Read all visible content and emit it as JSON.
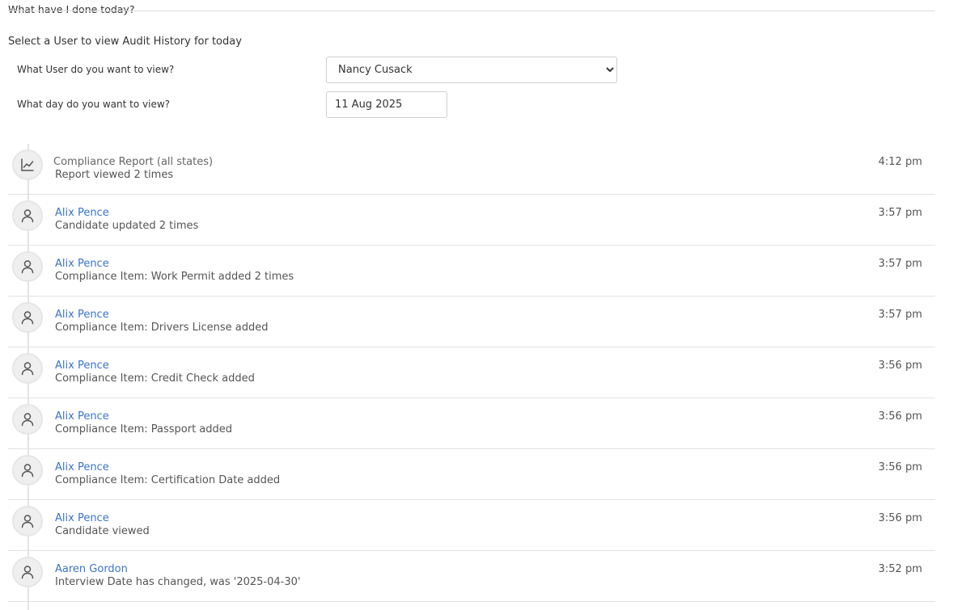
{
  "header": {
    "legend": "What have I done today?",
    "intro": "Select a User to view Audit History for today"
  },
  "form": {
    "user_label": "What User do you want to view?",
    "user_selected": "Nancy Cusack",
    "day_label": "What day do you want to view?",
    "day_value": "11 Aug 2025"
  },
  "entries": [
    {
      "icon": "chart-line-icon",
      "title": "Compliance Report (all states)",
      "link": false,
      "desc": "Report viewed 2 times",
      "time": "4:12 pm"
    },
    {
      "icon": "user-icon",
      "title": "Alix Pence",
      "link": true,
      "desc": "Candidate updated 2 times",
      "time": "3:57 pm"
    },
    {
      "icon": "user-icon",
      "title": "Alix Pence",
      "link": true,
      "desc": "Compliance Item: Work Permit added 2 times",
      "time": "3:57 pm"
    },
    {
      "icon": "user-icon",
      "title": "Alix Pence",
      "link": true,
      "desc": "Compliance Item: Drivers License added",
      "time": "3:57 pm"
    },
    {
      "icon": "user-icon",
      "title": "Alix Pence",
      "link": true,
      "desc": "Compliance Item: Credit Check added",
      "time": "3:56 pm"
    },
    {
      "icon": "user-icon",
      "title": "Alix Pence",
      "link": true,
      "desc": "Compliance Item: Passport added",
      "time": "3:56 pm"
    },
    {
      "icon": "user-icon",
      "title": "Alix Pence",
      "link": true,
      "desc": "Compliance Item: Certification Date added",
      "time": "3:56 pm"
    },
    {
      "icon": "user-icon",
      "title": "Alix Pence",
      "link": true,
      "desc": "Candidate viewed",
      "time": "3:56 pm"
    },
    {
      "icon": "user-icon",
      "title": "Aaren Gordon",
      "link": true,
      "desc": "Interview Date has changed, was '2025-04-30'",
      "time": "3:52 pm"
    }
  ]
}
